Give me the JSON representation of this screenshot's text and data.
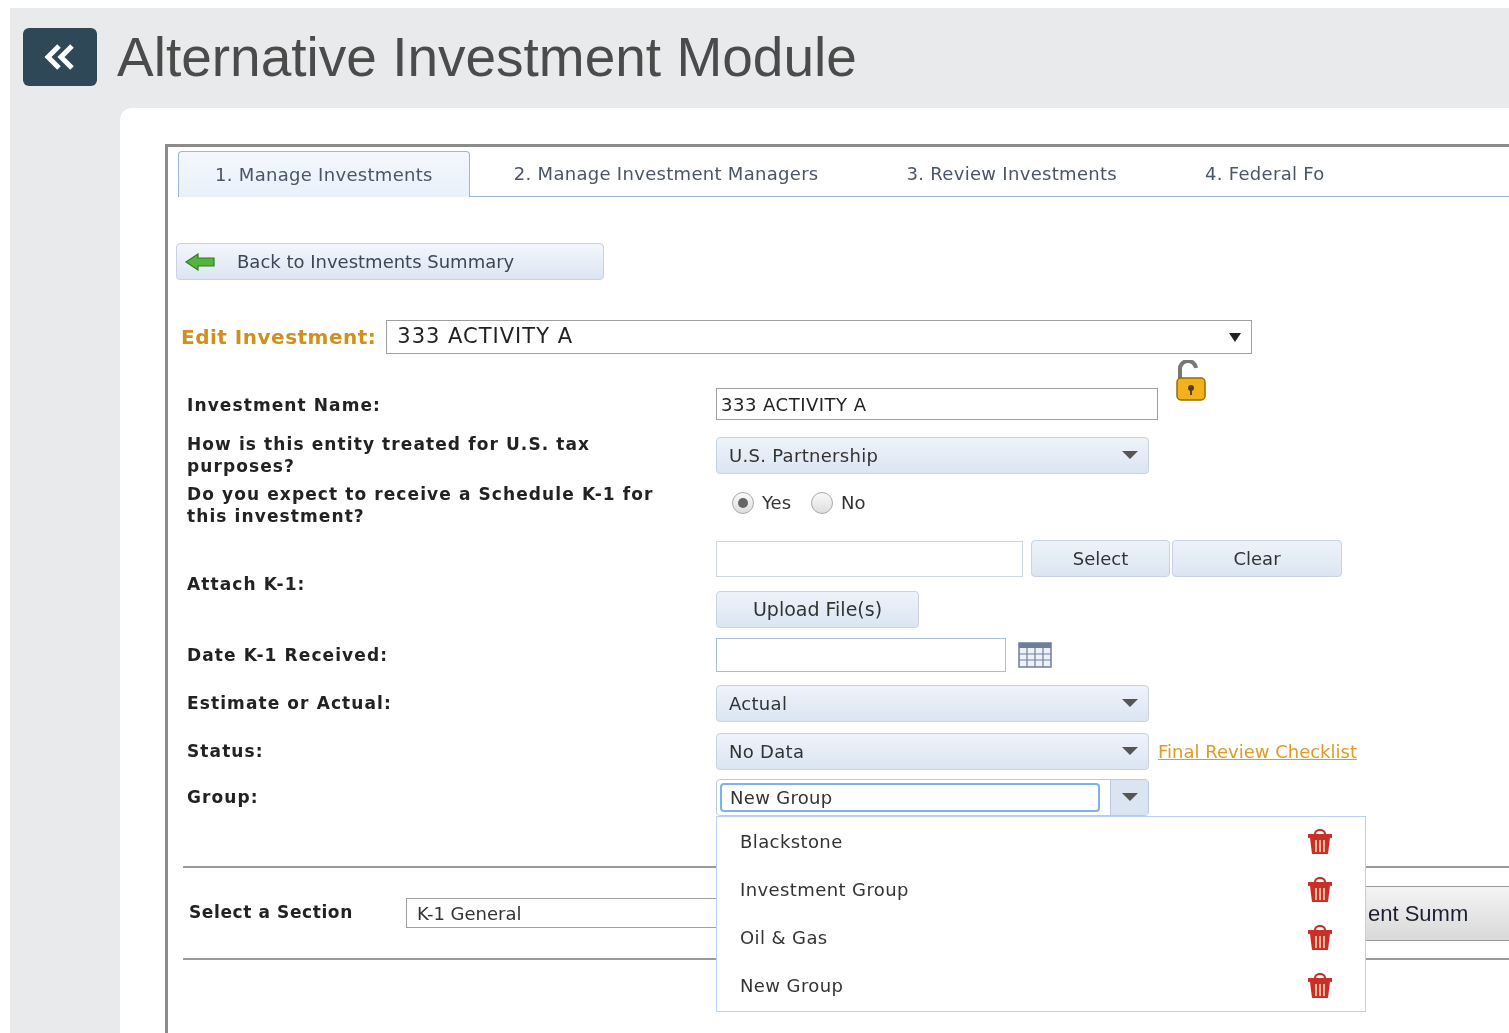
{
  "header": {
    "title": "Alternative Investment Module"
  },
  "tabs": [
    {
      "label": "1. Manage Investments",
      "selected": true
    },
    {
      "label": "2. Manage Investment Managers",
      "selected": false
    },
    {
      "label": "3. Review Investments",
      "selected": false
    },
    {
      "label": "4. Federal Fo",
      "selected": false
    }
  ],
  "back_button": "Back to Investments Summary",
  "edit_investment": {
    "label": "Edit Investment:",
    "value": "333 ACTIVITY A"
  },
  "fields": [
    {
      "kind": "text",
      "label": "Investment Name:",
      "value": "333 ACTIVITY A",
      "lockable": true
    },
    {
      "kind": "select",
      "label": "How is this entity treated for U.S. tax purposes?",
      "value": "U.S. Partnership"
    },
    {
      "kind": "radio",
      "label": "Do you expect to receive a Schedule K-1 for this investment?",
      "options": [
        {
          "label": "Yes",
          "selected": true
        },
        {
          "label": "No",
          "selected": false
        }
      ]
    },
    {
      "kind": "attach",
      "label": "Attach K-1:",
      "buttons": [
        "Select",
        "Clear"
      ],
      "upload": "Upload File(s)"
    },
    {
      "kind": "date",
      "label": "Date K-1 Received:"
    },
    {
      "kind": "select",
      "label": "Estimate or Actual:",
      "value": "Actual"
    },
    {
      "kind": "select",
      "label": "Status:",
      "value": "No Data",
      "link": "Final Review Checklist"
    },
    {
      "kind": "combo",
      "label": "Group:",
      "value": "New Group",
      "expanded": true,
      "options": [
        "Blackstone",
        "Investment Group",
        "Oil & Gas",
        "New Group"
      ]
    }
  ],
  "section": {
    "label": "Select a Section",
    "value": "K-1 General"
  },
  "summary_button": "ent Summ"
}
